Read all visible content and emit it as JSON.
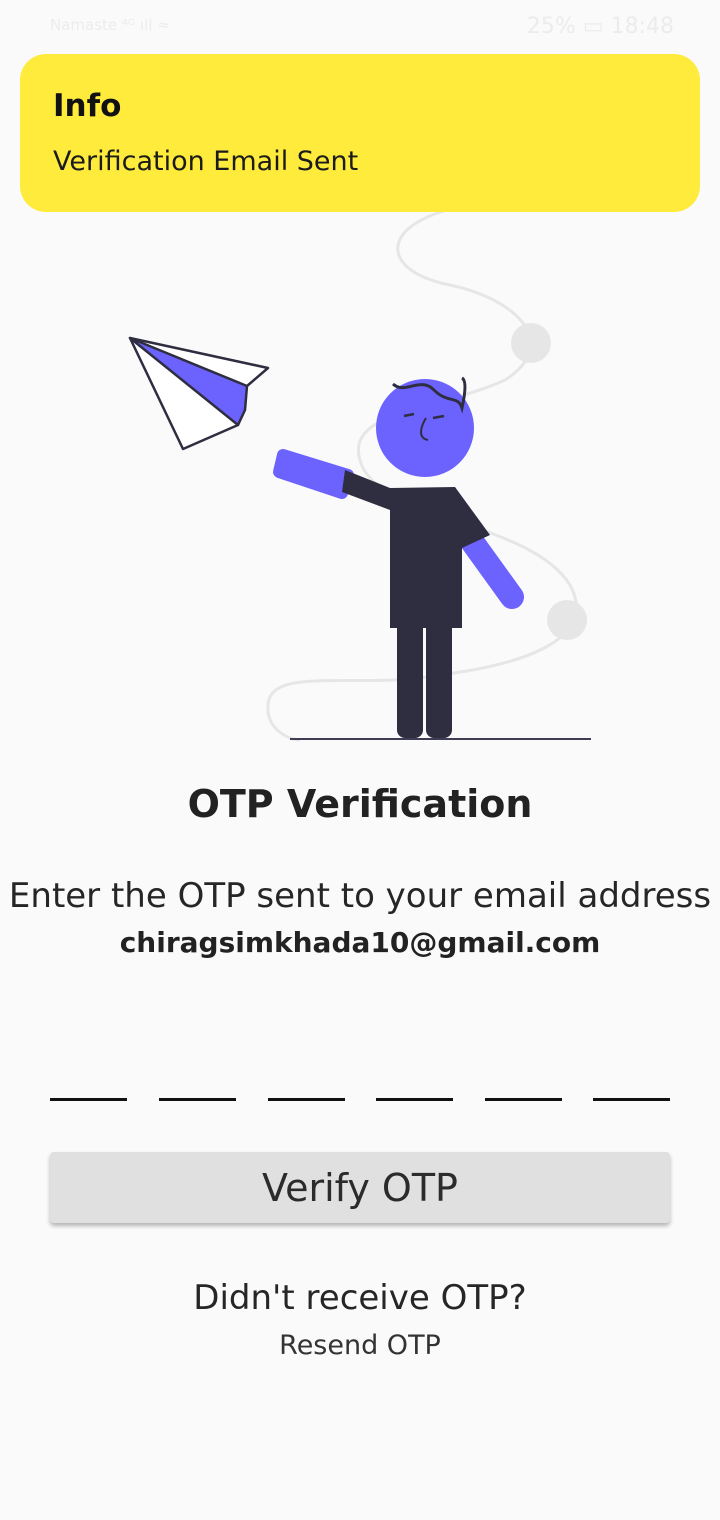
{
  "status_bar": {
    "left_text": "Namaste ⁴ᴳ ıll ≈",
    "right_text": "25% ▭ 18:48"
  },
  "toast": {
    "title": "Info",
    "message": "Verification Email Sent",
    "color": "#ffeb3b"
  },
  "illustration": {
    "icons": [
      "paper-plane-icon",
      "person-figure"
    ],
    "accent_color": "#6c63ff",
    "dark_color": "#2f2e41"
  },
  "screen": {
    "title": "OTP Verification",
    "instruction": "Enter the OTP sent to your email address",
    "email": "chiragsimkhada10@gmail.com"
  },
  "otp": {
    "digits": [
      "",
      "",
      "",
      "",
      "",
      ""
    ]
  },
  "actions": {
    "verify_label": "Verify OTP",
    "didnt_receive_label": "Didn't receive OTP?",
    "resend_label": "Resend OTP"
  }
}
